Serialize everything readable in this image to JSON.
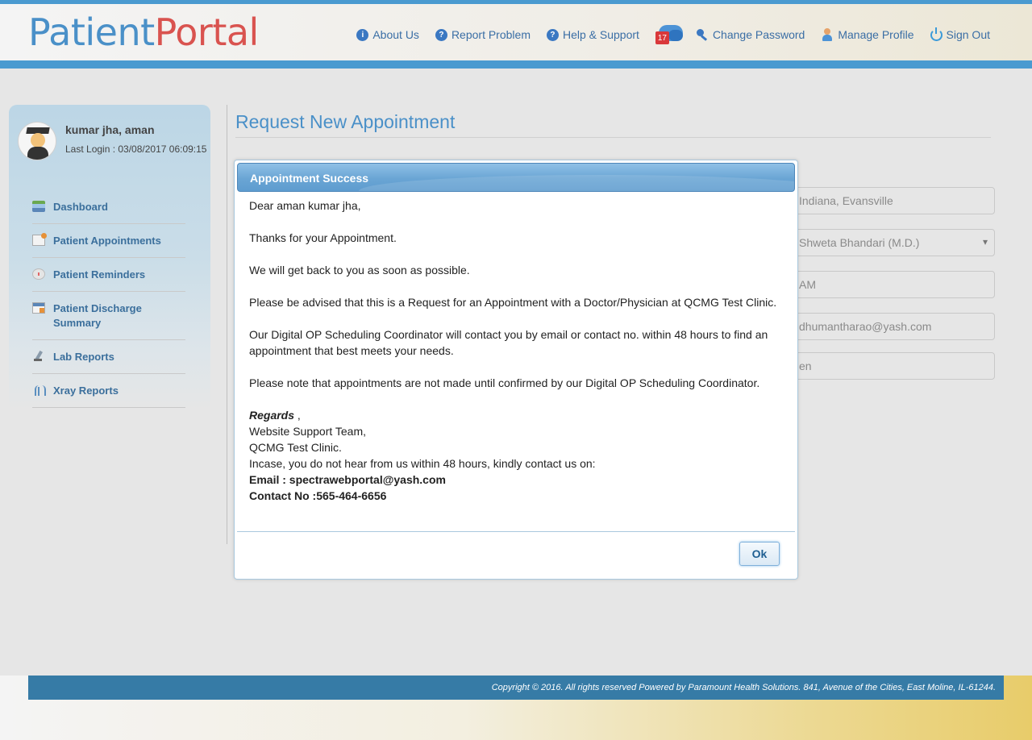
{
  "header": {
    "logo_part1": "Patient",
    "logo_part2": "Portal",
    "nav": {
      "about": "About Us",
      "report": "Report Problem",
      "help": "Help & Support",
      "notifications_count": "17",
      "change_password": "Change Password",
      "manage_profile": "Manage Profile",
      "sign_out": "Sign Out"
    }
  },
  "sidebar": {
    "user_name": "kumar jha, aman",
    "last_login": "Last Login : 03/08/2017 06:09:15",
    "menu": [
      {
        "label": "Dashboard"
      },
      {
        "label": "Patient Appointments"
      },
      {
        "label": "Patient Reminders"
      },
      {
        "label": "Patient Discharge Summary"
      },
      {
        "label": "Lab Reports"
      },
      {
        "label": "Xray Reports"
      }
    ]
  },
  "main": {
    "title": "Request New Appointment",
    "fields": {
      "location": "Indiana, Evansville",
      "doctor": "Shweta Bhandari (M.D.)",
      "time": "AM",
      "email": "dhumantharao@yash.com",
      "status": "en"
    }
  },
  "dialog": {
    "title": "Appointment Success",
    "greeting": "Dear aman kumar jha,",
    "thanks": "Thanks for your Appointment.",
    "get_back": "We will get back to you as soon as possible.",
    "advice": "Please be advised that this is a Request for an Appointment with a Doctor/Physician at QCMG Test Clinic.",
    "coordinator": "Our Digital OP Scheduling Coordinator will contact you by email or contact no. within 48 hours to find an appointment that best meets your needs.",
    "note": "Please note that appointments are not made until confirmed by our Digital OP Scheduling Coordinator.",
    "regards": "Regards",
    "regards_comma": " ,",
    "team": "Website Support Team,",
    "clinic": "QCMG Test Clinic.",
    "incase": "Incase, you do not hear from us within 48 hours, kindly contact us on:",
    "email_line": "Email : spectrawebportal@yash.com",
    "contact_line": "Contact No :565-464-6656",
    "ok_label": "Ok"
  },
  "footer": {
    "copyright": "Copyright © 2016. All rights reserved Powered by Paramount Health Solutions. 841, Avenue of the Cities, East Moline, IL-61244."
  }
}
